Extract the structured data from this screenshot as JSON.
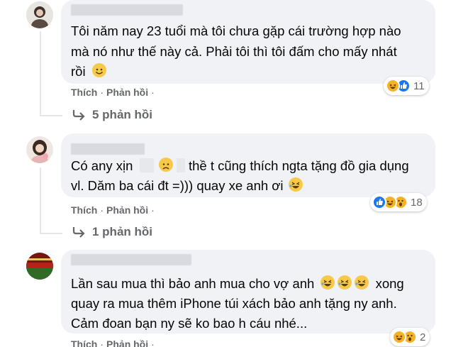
{
  "comments": [
    {
      "lines": [
        "Tôi năm nay 23 tuổi mà tôi chưa gặp cái trường hợp nào",
        "mà nó như thế này cả. Phải tôi thì tôi đấm cho mấy nhát",
        "rồi"
      ],
      "like_label": "Thích",
      "reply_label": "Phản hồi",
      "reaction_icons": [
        "haha-icon",
        "like-icon"
      ],
      "reaction_count": "11",
      "replies_label": "5 phản hồi"
    },
    {
      "line1_a": "Có any xịn",
      "line1_b": "thề t cũng thích ngta tặng đồ gia dụng",
      "line2": "vl. Dăm ba cái đt =))) quay xe anh ơi",
      "like_label": "Thích",
      "reply_label": "Phản hồi",
      "reaction_icons": [
        "like-icon",
        "haha-icon",
        "wow-icon"
      ],
      "reaction_count": "18",
      "replies_label": "1 phản hồi"
    },
    {
      "line1_a": "Lần sau mua thì bảo anh mua cho vợ anh",
      "line1_b": "xong",
      "line2": "quay ra mua thêm iPhone túi xách bảo anh tặng ny anh.",
      "line3": "Cảm đoan bạn ny sẽ ko bao h cáu nhé...",
      "like_label": "Thích",
      "reply_label": "Phản hồi",
      "reaction_icons": [
        "haha-icon",
        "wow-icon"
      ],
      "reaction_count": "2"
    }
  ],
  "colors": {
    "bubble": "#f0f2f5",
    "meta_text": "#65676b",
    "like_blue": "#1877f2",
    "haha_yellow": "#f7b125"
  }
}
